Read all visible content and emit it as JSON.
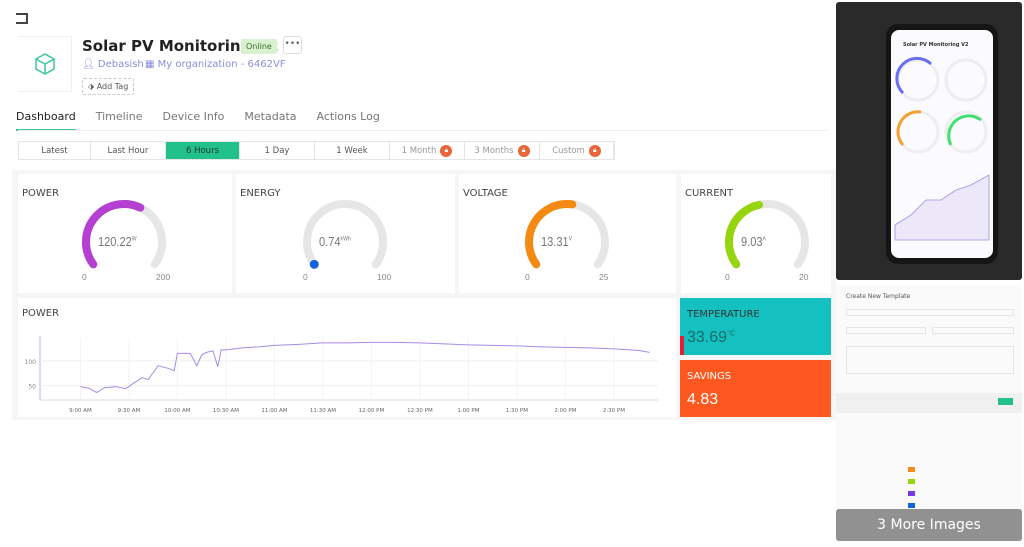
{
  "header": {
    "title": "Solar PV Monitoring V2",
    "status": "Online",
    "more_label": "•••",
    "owner": "Debasish",
    "organization": "My organization - 6462VF",
    "add_tag": "Add Tag"
  },
  "tabs": [
    {
      "label": "Dashboard",
      "active": true
    },
    {
      "label": "Timeline"
    },
    {
      "label": "Device Info"
    },
    {
      "label": "Metadata"
    },
    {
      "label": "Actions Log"
    }
  ],
  "ranges": [
    {
      "label": "Latest"
    },
    {
      "label": "Last Hour"
    },
    {
      "label": "6 Hours",
      "active": true
    },
    {
      "label": "1 Day"
    },
    {
      "label": "1 Week"
    },
    {
      "label": "1 Month",
      "locked": true
    },
    {
      "label": "3 Months",
      "locked": true
    },
    {
      "label": "Custom",
      "locked": true
    }
  ],
  "gauges": [
    {
      "title": "POWER",
      "value": "120.22",
      "unit": "W",
      "min": "0",
      "max": "200",
      "fraction": 0.601,
      "color": "#b43fd0"
    },
    {
      "title": "ENERGY",
      "value": "0.74",
      "unit": "kWh",
      "min": "0",
      "max": "100",
      "fraction": 0.0074,
      "color": "#1464d8"
    },
    {
      "title": "VOLTAGE",
      "value": "13.31",
      "unit": "V",
      "min": "0",
      "max": "25",
      "fraction": 0.532,
      "color": "#f58a12"
    },
    {
      "title": "CURRENT",
      "value": "9.03",
      "unit": "A",
      "min": "0",
      "max": "20",
      "fraction": 0.4515,
      "color": "#96d40e"
    }
  ],
  "tiles": {
    "temperature": {
      "title": "TEMPERATURE",
      "value": "33.69",
      "unit": "°C",
      "color": "#14c0c0"
    },
    "savings": {
      "title": "SAVINGS",
      "value": "4.83",
      "color": "#fc5820"
    }
  },
  "chart_data": {
    "type": "line",
    "title": "POWER",
    "yticks": [
      "50",
      "100"
    ],
    "ylim": [
      25,
      150
    ],
    "xticks": [
      "9:00 AM",
      "9:30 AM",
      "10:00 AM",
      "10:30 AM",
      "11:00 AM",
      "11:30 AM",
      "12:00 PM",
      "12:30 PM",
      "1:00 PM",
      "1:30 PM",
      "2:00 PM",
      "2:30 PM"
    ],
    "color": "#a78be8",
    "x": [
      "09:00",
      "09:05",
      "09:10",
      "09:15",
      "09:22",
      "09:28",
      "09:33",
      "09:38",
      "09:42",
      "09:48",
      "09:54",
      "09:58",
      "10:00",
      "10:08",
      "10:12",
      "10:15",
      "10:18",
      "10:22",
      "10:25",
      "10:27",
      "10:30",
      "10:40",
      "10:50",
      "11:00",
      "11:15",
      "11:30",
      "11:45",
      "12:00",
      "12:15",
      "12:30",
      "12:45",
      "13:00",
      "13:15",
      "13:30",
      "13:45",
      "14:00",
      "14:15",
      "14:30",
      "14:45",
      "14:52"
    ],
    "y": [
      48,
      45,
      36,
      46,
      48,
      44,
      55,
      66,
      62,
      90,
      85,
      80,
      115,
      115,
      90,
      112,
      117,
      120,
      88,
      122,
      122,
      126,
      128,
      131,
      133,
      136,
      136,
      137,
      137,
      136,
      134,
      132,
      131,
      130,
      128,
      127,
      126,
      124,
      121,
      117
    ]
  },
  "side": {
    "more_images": "3 More Images",
    "template_title": "Create New Template"
  }
}
